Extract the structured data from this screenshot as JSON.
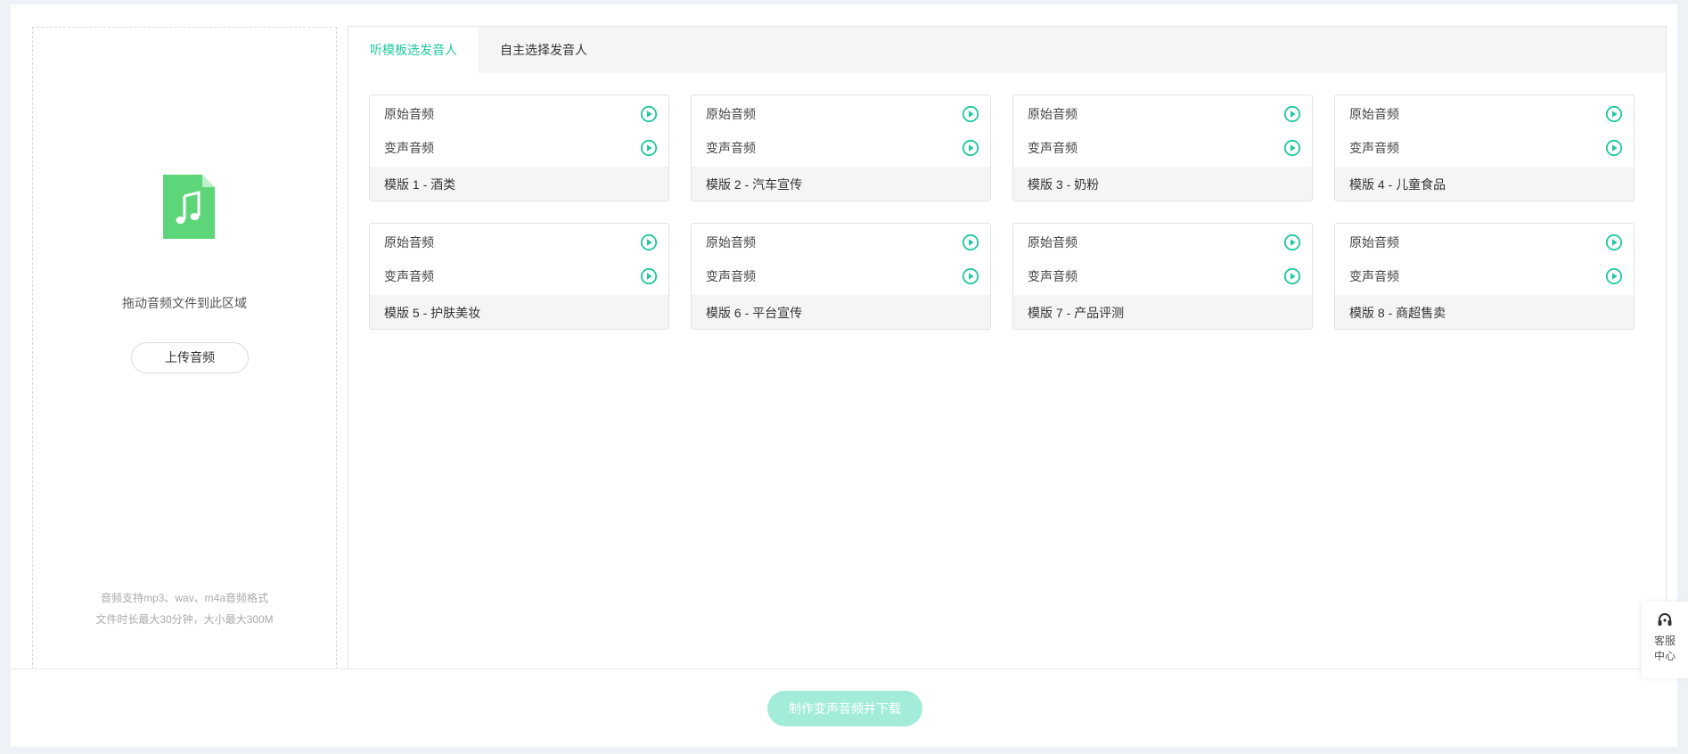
{
  "upload": {
    "drag_text": "拖动音频文件到此区域",
    "button_label": "上传音频",
    "hint_formats": "音频支持mp3、wav、m4a音频格式",
    "hint_limits": "文件时长最大30分钟，大小最大300M"
  },
  "tabs": [
    {
      "label": "听模板选发音人",
      "active": true
    },
    {
      "label": "自主选择发音人",
      "active": false
    }
  ],
  "templates": [
    {
      "original": "原始音频",
      "converted": "变声音频",
      "title": "模版 1 - 酒类"
    },
    {
      "original": "原始音频",
      "converted": "变声音频",
      "title": "模版 2 - 汽车宣传"
    },
    {
      "original": "原始音频",
      "converted": "变声音频",
      "title": "模版 3 - 奶粉"
    },
    {
      "original": "原始音频",
      "converted": "变声音频",
      "title": "模版 4 - 儿童食品"
    },
    {
      "original": "原始音频",
      "converted": "变声音频",
      "title": "模版 5 - 护肤美妆"
    },
    {
      "original": "原始音频",
      "converted": "变声音频",
      "title": "模版 6 - 平台宣传"
    },
    {
      "original": "原始音频",
      "converted": "变声音频",
      "title": "模版 7 - 产品评测"
    },
    {
      "original": "原始音频",
      "converted": "变声音频",
      "title": "模版 8 - 商超售卖"
    }
  ],
  "footer": {
    "make_button": "制作变声音频并下载"
  },
  "service": {
    "line1": "客服",
    "line2": "中心",
    "icon": "headset-icon"
  },
  "colors": {
    "accent": "#1ec8a0",
    "file_icon": "#5dd67a",
    "disabled_button": "#a3ecd9"
  }
}
